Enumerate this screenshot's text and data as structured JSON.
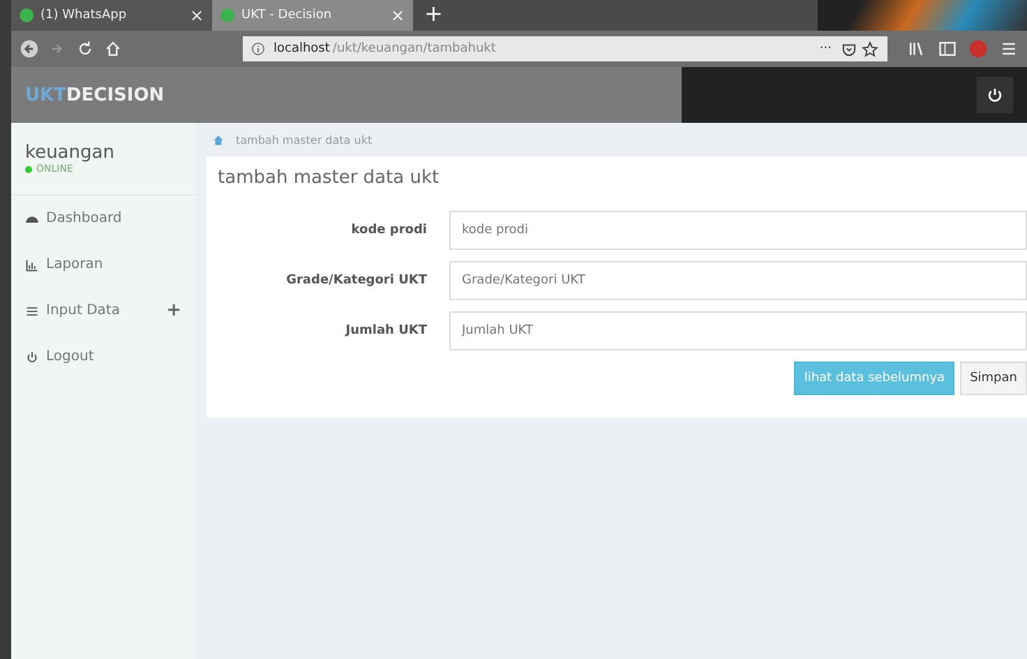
{
  "browser": {
    "tabs": [
      {
        "title": "(1) WhatsApp",
        "selected": false,
        "close": "×"
      },
      {
        "title": "UKT - Decision",
        "selected": true,
        "close": "×"
      }
    ],
    "new_tab": "+",
    "address": {
      "host": "localhost",
      "path": "/ukt/keuangan/tambahukt"
    },
    "page_actions": "···"
  },
  "header": {
    "brand_accent": "UKT",
    "brand": "DECISION"
  },
  "sidebar": {
    "user": "keuangan",
    "status": "ONLINE",
    "items": [
      {
        "label": "Dashboard"
      },
      {
        "label": "Laporan"
      },
      {
        "label": "Input Data",
        "expand": "+"
      },
      {
        "label": "Logout"
      }
    ]
  },
  "breadcrumb": "tambah master data ukt",
  "form": {
    "title": "tambah master data ukt",
    "fields": [
      {
        "label": "kode prodi",
        "placeholder": "kode prodi"
      },
      {
        "label": "Grade/Kategori UKT",
        "placeholder": "Grade/Kategori UKT"
      },
      {
        "label": "Jumlah UKT",
        "placeholder": "Jumlah UKT"
      }
    ],
    "buttons": [
      {
        "label": "lihat data sebelumnya",
        "kind": "info"
      },
      {
        "label": "Simpan",
        "kind": "default"
      }
    ]
  }
}
